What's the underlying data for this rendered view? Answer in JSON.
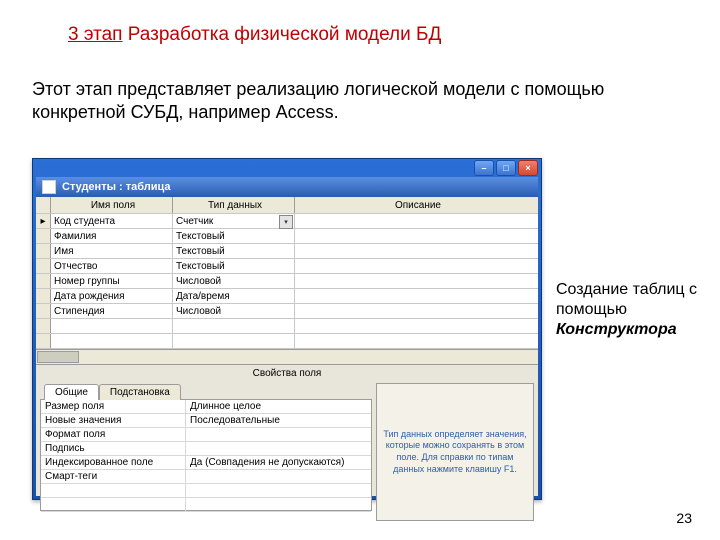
{
  "title": {
    "stage": "3 этап",
    "rest": "  Разработка физической модели БД"
  },
  "intro": "Этот этап представляет реализацию логической модели с помощью конкретной СУБД, например Access.",
  "window": {
    "title": "Студенты : таблица",
    "columns": {
      "name": "Имя поля",
      "type": "Тип данных",
      "desc": "Описание"
    },
    "rows": [
      {
        "selector": "▸",
        "name": "Код студента",
        "type": "Счетчик",
        "dropdown": true
      },
      {
        "selector": "",
        "name": "Фамилия",
        "type": "Текстовый"
      },
      {
        "selector": "",
        "name": "Имя",
        "type": "Текстовый"
      },
      {
        "selector": "",
        "name": "Отчество",
        "type": "Текстовый"
      },
      {
        "selector": "",
        "name": "Номер группы",
        "type": "Числовой"
      },
      {
        "selector": "",
        "name": "Дата рождения",
        "type": "Дата/время"
      },
      {
        "selector": "",
        "name": "Стипендия",
        "type": "Числовой"
      }
    ],
    "props_header": "Свойства поля",
    "tabs": {
      "general": "Общие",
      "lookup": "Подстановка"
    },
    "props": [
      {
        "label": "Размер поля",
        "value": "Длинное целое"
      },
      {
        "label": "Новые значения",
        "value": "Последовательные"
      },
      {
        "label": "Формат поля",
        "value": ""
      },
      {
        "label": "Подпись",
        "value": ""
      },
      {
        "label": "Индексированное поле",
        "value": "Да (Совпадения не допускаются)"
      },
      {
        "label": "Смарт-теги",
        "value": ""
      }
    ],
    "hint": "Тип данных определяет значения, которые можно сохранять в этом поле.  Для справки по типам данных нажмите клавишу F1."
  },
  "side_caption": {
    "line1": "Создание таблиц с помощью ",
    "em": "Конструктора"
  },
  "page_number": "23"
}
